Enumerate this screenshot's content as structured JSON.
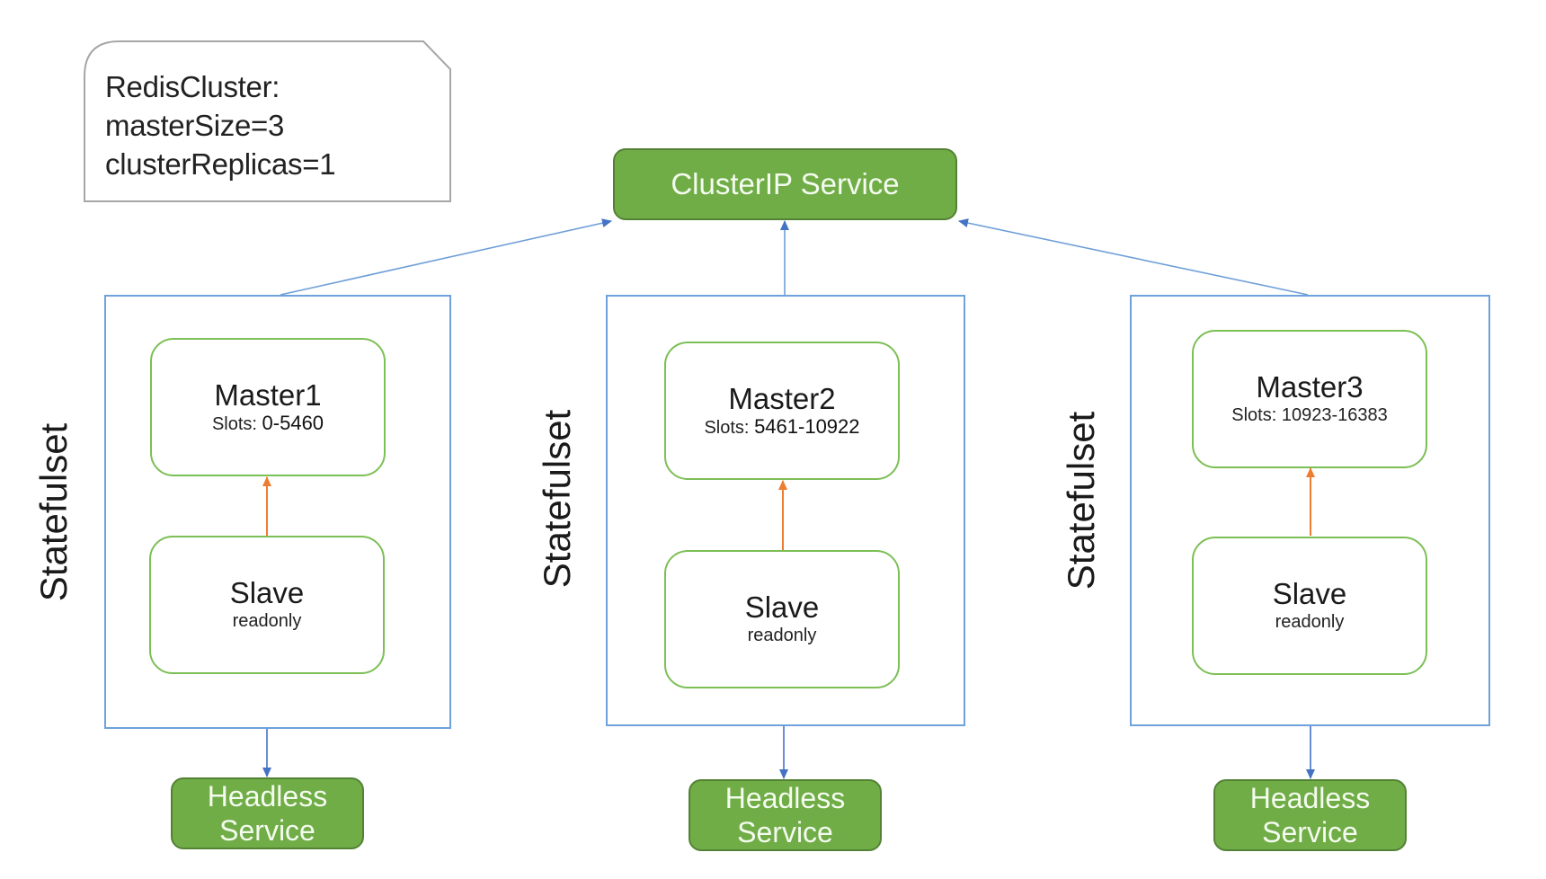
{
  "note": {
    "lines": [
      "RedisCluster:",
      "masterSize=3",
      "clusterReplicas=1"
    ]
  },
  "clusterip_service": {
    "label": "ClusterIP Service"
  },
  "statefulsets": [
    {
      "label": "Statefulset",
      "master": {
        "title": "Master1",
        "slots_label": "Slots:",
        "slots_range": "0-5460"
      },
      "slave": {
        "title": "Slave",
        "mode": "readonly"
      },
      "headless": {
        "line1": "Headless",
        "line2": "Service"
      }
    },
    {
      "label": "Statefulset",
      "master": {
        "title": "Master2",
        "slots_label": "Slots:",
        "slots_range": "5461-10922"
      },
      "slave": {
        "title": "Slave",
        "mode": "readonly"
      },
      "headless": {
        "line1": "Headless",
        "line2": "Service"
      }
    },
    {
      "label": "Statefulset",
      "master": {
        "title": "Master3",
        "slots_label": "Slots:",
        "slots_range": "10923-16383"
      },
      "slave": {
        "title": "Slave",
        "mode": "readonly"
      },
      "headless": {
        "line1": "Headless",
        "line2": "Service"
      }
    }
  ],
  "colors": {
    "service_fill": "#70ad47",
    "service_border": "#548235",
    "pod_border": "#7cbf55",
    "statefulset_border": "#6fa1dc",
    "service_arrow": "#4472c4",
    "replication_arrow": "#ed7d31",
    "note_border": "#a6a6a6"
  }
}
